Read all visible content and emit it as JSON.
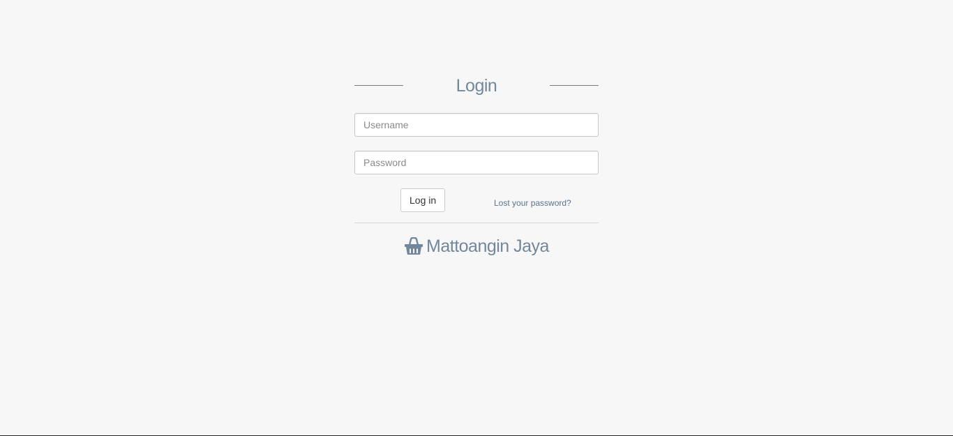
{
  "login": {
    "title": "Login",
    "username_placeholder": "Username",
    "password_placeholder": "Password",
    "submit_label": "Log in",
    "lost_password_label": "Lost your password?"
  },
  "brand": {
    "icon": "shopping-basket-icon",
    "name": "Mattoangin Jaya"
  },
  "colors": {
    "background": "#f7f7f7",
    "heading": "#73879c",
    "link": "#5a738e"
  }
}
